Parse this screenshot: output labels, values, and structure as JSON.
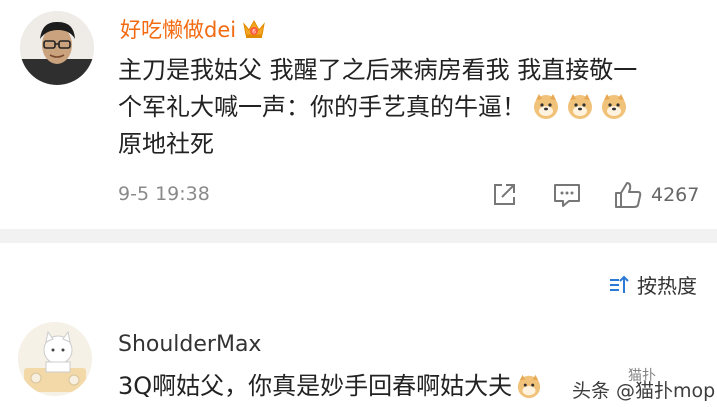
{
  "comment1": {
    "username": "好吃懒做dei",
    "lines": [
      "主刀是我姑父 我醒了之后来病房看我 我直接敬一",
      "个军礼大喊一声：你的手艺真的牛逼！",
      "原地社死"
    ],
    "timestamp": "9-5 19:38",
    "likes": "4267",
    "icons": [
      "avatar",
      "vip-crown-icon",
      "doge-emoji-icon",
      "share-icon",
      "comment-icon",
      "like-icon"
    ]
  },
  "sort": {
    "label": "按热度",
    "icon": "sort-icon"
  },
  "comment2": {
    "username": "ShoulderMax",
    "text": "3Q啊姑父，你真是妙手回春啊姑大夫"
  },
  "watermark": {
    "line1": "猫扑",
    "line2": "头条 @猫扑mop"
  },
  "colors": {
    "username_orange": "#f26b12",
    "text": "#222222",
    "meta": "#8a8a8a",
    "separator": "#f2f2f2"
  }
}
